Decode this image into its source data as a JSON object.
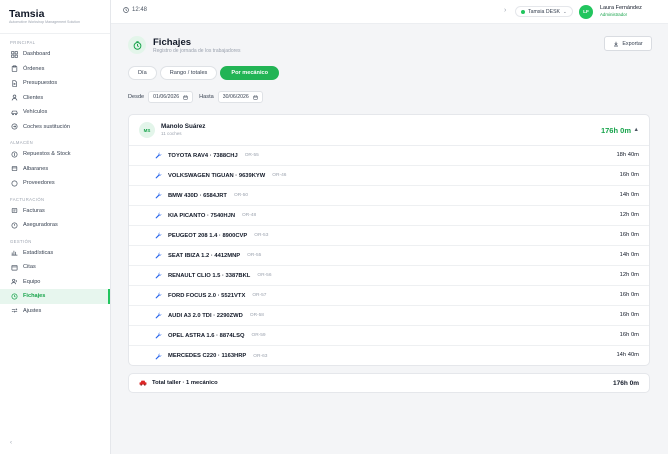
{
  "brand": {
    "name": "Tamsia",
    "tagline": "Automotive Workshop Management Solution"
  },
  "sidebar": {
    "sections": [
      {
        "label": "PRINCIPAL",
        "items": [
          {
            "label": "Dashboard",
            "icon": "grid-icon"
          },
          {
            "label": "Órdenes",
            "icon": "clipboard-icon"
          },
          {
            "label": "Presupuestos",
            "icon": "document-icon"
          },
          {
            "label": "Clientes",
            "icon": "user-icon"
          },
          {
            "label": "Vehículos",
            "icon": "car-icon"
          },
          {
            "label": "Coches sustitución",
            "icon": "swap-icon"
          }
        ]
      },
      {
        "label": "ALMACÉN",
        "items": [
          {
            "label": "Repuestos & Stock",
            "icon": "box-icon"
          },
          {
            "label": "Albaranes",
            "icon": "receipt-icon"
          },
          {
            "label": "Proveedores",
            "icon": "truck-icon"
          }
        ]
      },
      {
        "label": "FACTURACIÓN",
        "items": [
          {
            "label": "Facturas",
            "icon": "invoice-icon"
          },
          {
            "label": "Aseguradoras",
            "icon": "shield-icon"
          }
        ]
      },
      {
        "label": "GESTIÓN",
        "items": [
          {
            "label": "Estadísticas",
            "icon": "chart-icon"
          },
          {
            "label": "Citas",
            "icon": "calendar-icon"
          },
          {
            "label": "Equipo",
            "icon": "team-icon"
          },
          {
            "label": "Fichajes",
            "icon": "clock-icon",
            "active": true
          },
          {
            "label": "Ajustes",
            "icon": "settings-icon"
          }
        ]
      }
    ],
    "collapse": "‹"
  },
  "topbar": {
    "time": "12:48",
    "workspace": "Tamsia DESK",
    "avatar_initials": "LF",
    "user_name": "Laura Fernández",
    "user_role": "Administrador"
  },
  "page": {
    "title": "Fichajes",
    "subtitle": "Registro de jornada de los trabajadores",
    "export_label": "Exportar",
    "tabs": [
      {
        "label": "Día",
        "active": false
      },
      {
        "label": "Rango / totales",
        "active": false
      },
      {
        "label": "Por mecánico",
        "active": true
      }
    ],
    "range": {
      "from_label": "Desde",
      "from_value": "01/06/2026",
      "to_label": "Hasta",
      "to_value": "30/06/2026"
    }
  },
  "mechanic": {
    "initials": "MS",
    "name": "Manolo Suárez",
    "subtitle": "11 coches",
    "total": "176h 0m",
    "rows": [
      {
        "car": "TOYOTA RAV4 · 7388CHJ",
        "order": "OR-55",
        "hours": "18h 40m"
      },
      {
        "car": "VOLKSWAGEN TIGUAN · 9639KYW",
        "order": "OR-46",
        "hours": "16h 0m"
      },
      {
        "car": "BMW 430D · 6584JRT",
        "order": "OR-50",
        "hours": "14h 0m"
      },
      {
        "car": "KIA PICANTO · 7540HJN",
        "order": "OR-48",
        "hours": "12h 0m"
      },
      {
        "car": "PEUGEOT 208 1.4 · 8900CVP",
        "order": "OR-53",
        "hours": "16h 0m"
      },
      {
        "car": "SEAT IBIZA 1.2 · 4412MNP",
        "order": "OR-55",
        "hours": "14h 0m"
      },
      {
        "car": "RENAULT CLIO 1.5 · 3387BKL",
        "order": "OR-56",
        "hours": "12h 0m"
      },
      {
        "car": "FORD FOCUS 2.0 · 5521VTX",
        "order": "OR-57",
        "hours": "16h 0m"
      },
      {
        "car": "AUDI A3 2.0 TDI · 2290ZWD",
        "order": "OR-58",
        "hours": "16h 0m"
      },
      {
        "car": "OPEL ASTRA 1.6 · 8874LSQ",
        "order": "OR-59",
        "hours": "16h 0m"
      },
      {
        "car": "MERCEDES C220 · 1163HRP",
        "order": "OR-63",
        "hours": "14h 40m"
      }
    ]
  },
  "total": {
    "label": "Total taller · 1 mecánico",
    "value": "176h 0m"
  },
  "colors": {
    "accent": "#22b455",
    "accent_text": "#16a34a",
    "wrench": "#2563eb",
    "car_icon": "#dc2626"
  }
}
